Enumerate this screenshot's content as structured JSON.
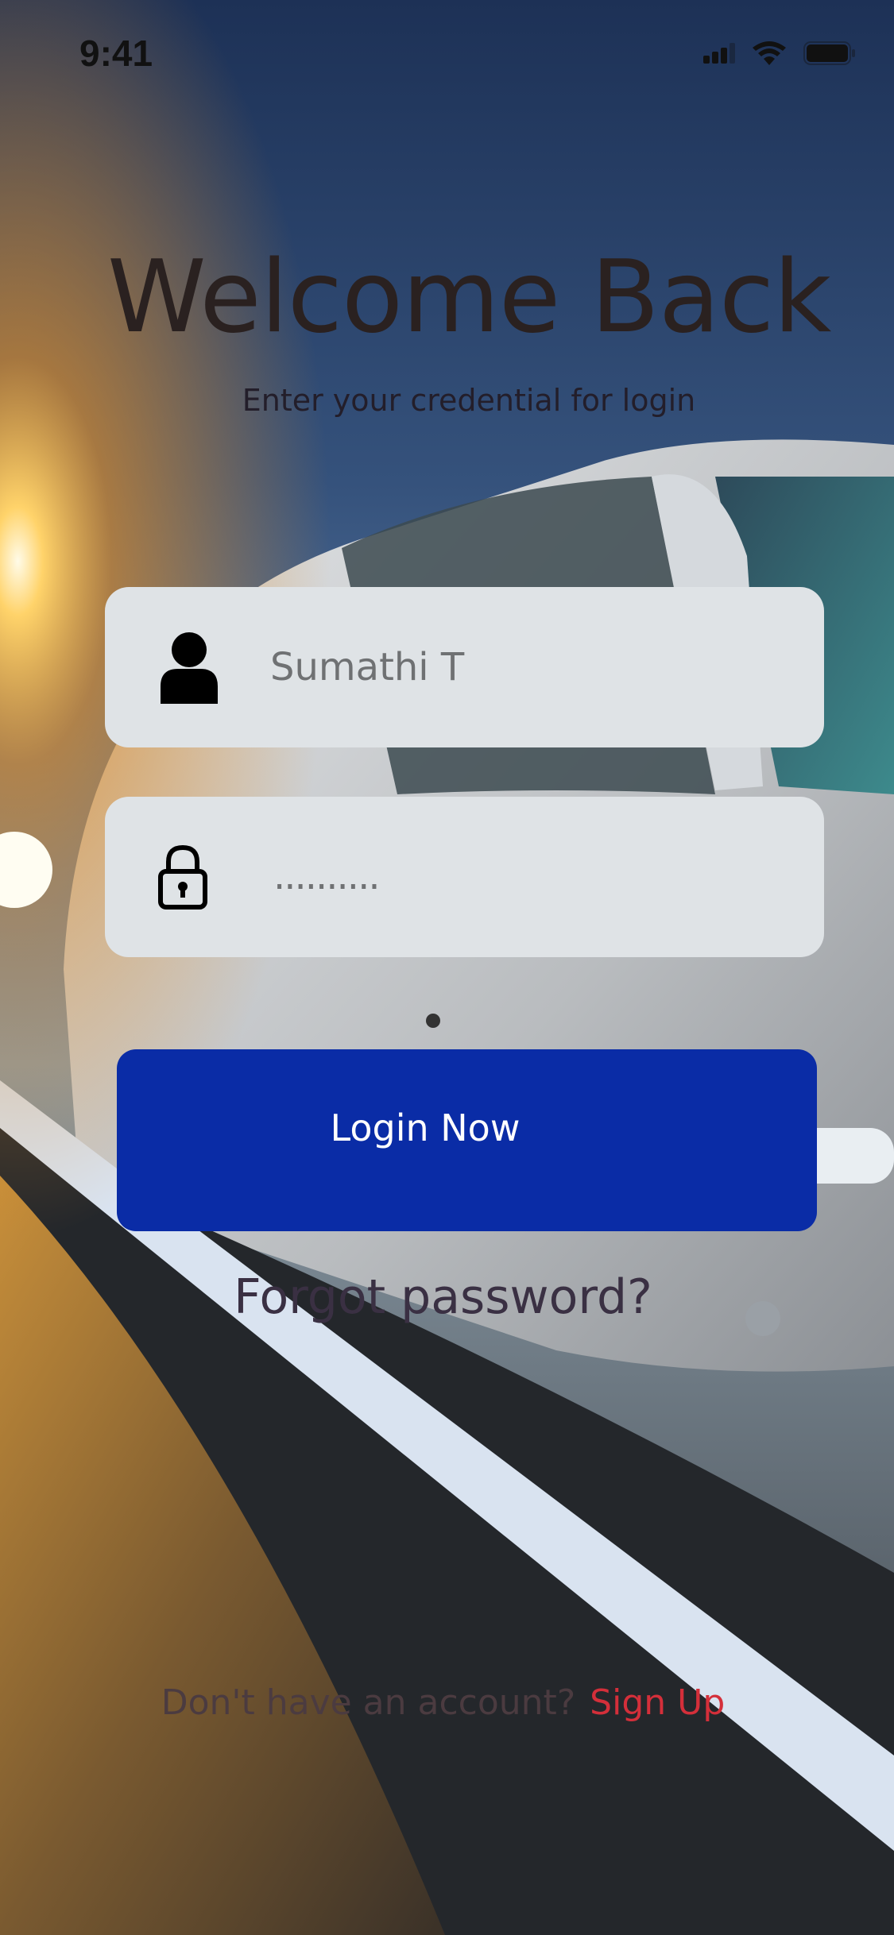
{
  "status_bar": {
    "time": "9:41",
    "icons": [
      "cellular-signal-icon",
      "wifi-icon",
      "battery-icon"
    ]
  },
  "header": {
    "title": "Welcome Back",
    "subtitle": "Enter your credential for login"
  },
  "form": {
    "username": {
      "value": "Sumathi T",
      "icon": "user-icon"
    },
    "password": {
      "masked_value": "..........",
      "icon": "lock-icon"
    },
    "login_label": "Login Now"
  },
  "links": {
    "forgot_password": "Forgot password?",
    "signup_prompt": "Don't have an account?",
    "signup_label": "Sign Up"
  },
  "colors": {
    "field_bg": "#dfe3e6",
    "button": "#0a2ca6",
    "signup_link": "#d42f3a",
    "title": "#2a2120"
  },
  "background": {
    "description_icon": "bus-road-sunset-photo"
  }
}
